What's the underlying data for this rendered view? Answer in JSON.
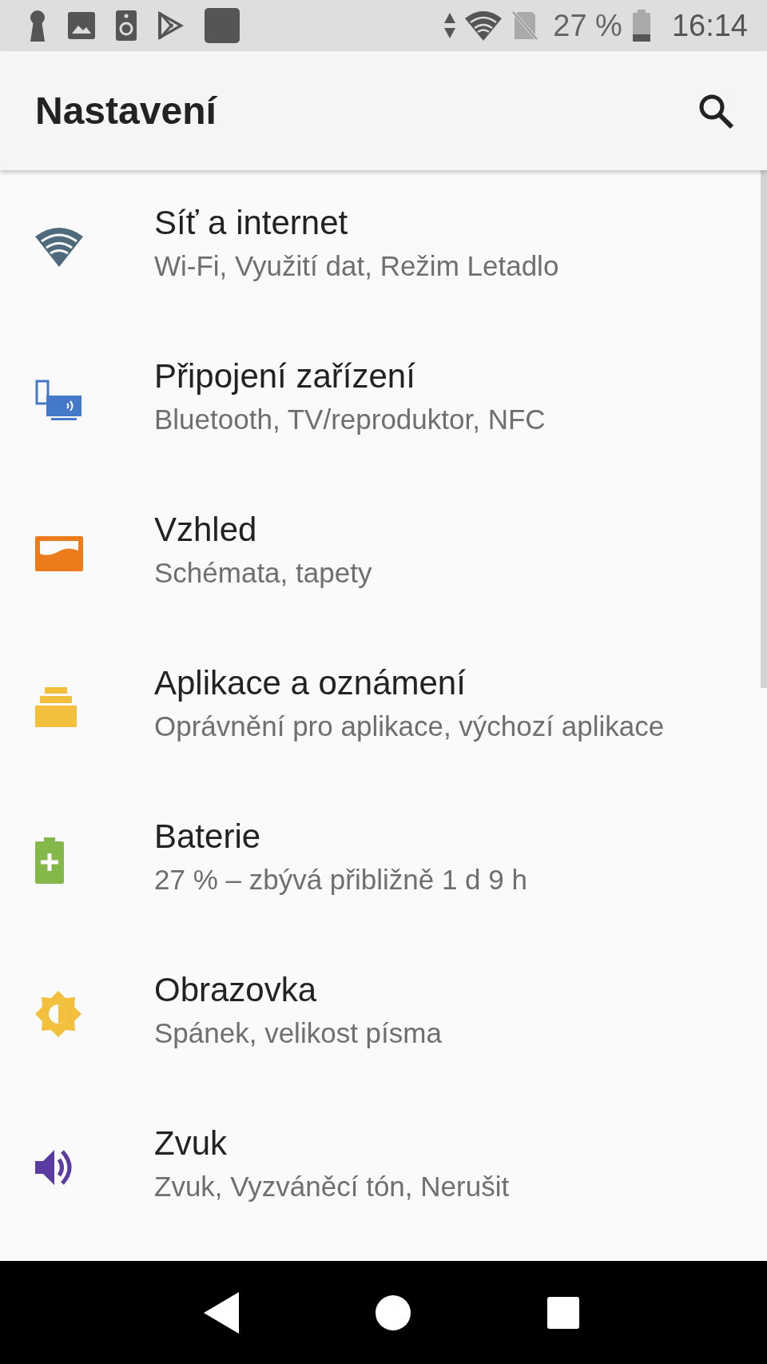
{
  "status_bar": {
    "battery": "27 %",
    "time": "16:14"
  },
  "app_bar": {
    "title": "Nastavení"
  },
  "items": [
    {
      "kind": "network",
      "title": "Síť a internet",
      "subtitle": "Wi-Fi, Využití dat, Režim Letadlo"
    },
    {
      "kind": "devices",
      "title": "Připojení zařízení",
      "subtitle": "Bluetooth, TV/reproduktor, NFC"
    },
    {
      "kind": "display-style",
      "title": "Vzhled",
      "subtitle": "Schémata, tapety"
    },
    {
      "kind": "apps",
      "title": "Aplikace a oznámení",
      "subtitle": "Oprávnění pro aplikace, výchozí aplikace"
    },
    {
      "kind": "battery",
      "title": "Baterie",
      "subtitle": "27 % – zbývá přibližně 1 d 9 h"
    },
    {
      "kind": "display",
      "title": "Obrazovka",
      "subtitle": "Spánek, velikost písma"
    },
    {
      "kind": "sound",
      "title": "Zvuk",
      "subtitle": "Zvuk, Vyzváněcí tón, Nerušit"
    }
  ]
}
